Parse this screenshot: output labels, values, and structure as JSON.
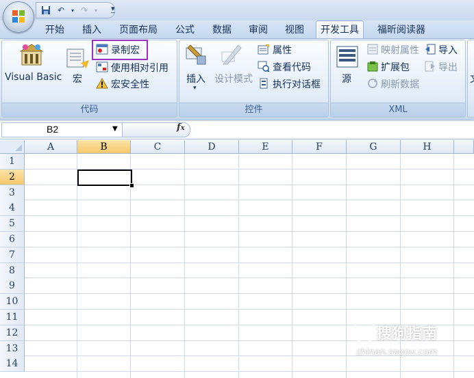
{
  "quick_access": {
    "save_icon": "save-icon",
    "undo_icon": "undo-icon",
    "redo_icon": "redo-icon",
    "customize_icon": "customize-qat-icon"
  },
  "tabs": [
    "开始",
    "插入",
    "页面布局",
    "公式",
    "数据",
    "审阅",
    "视图",
    "开发工具",
    "福昕阅读器"
  ],
  "active_tab": "开发工具",
  "ribbon": {
    "code": {
      "title": "代码",
      "visual_basic": "Visual Basic",
      "macro": "宏",
      "record_macro": "录制宏",
      "relative_ref": "使用相对引用",
      "macro_security": "宏安全性"
    },
    "controls": {
      "title": "控件",
      "insert": "插入",
      "design_mode": "设计模式",
      "properties": "属性",
      "view_code": "查看代码",
      "run_dialog": "执行对话框"
    },
    "xml": {
      "title": "XML",
      "source": "源",
      "map_props": "映射属性",
      "expansion_pack": "扩展包",
      "refresh_data": "刷新数据",
      "import": "导入",
      "export": "导出"
    },
    "extra_label": "文"
  },
  "formula_bar": {
    "name_box": "B2",
    "fx": "fx",
    "value": ""
  },
  "columns": [
    "A",
    "B",
    "C",
    "D",
    "E",
    "F",
    "G",
    "H"
  ],
  "selected_column": "B",
  "rows": [
    "1",
    "2",
    "3",
    "4",
    "5",
    "6",
    "7",
    "8",
    "9",
    "10",
    "11",
    "12",
    "13",
    "14"
  ],
  "selected_row": "2",
  "watermark": {
    "text": "搜狗指南",
    "url": "zhinan.sogou.com"
  },
  "colors": {
    "highlight_box": "#9a2fc1",
    "selected_header": "#f6c86c",
    "ribbon_text": "#15315c"
  }
}
